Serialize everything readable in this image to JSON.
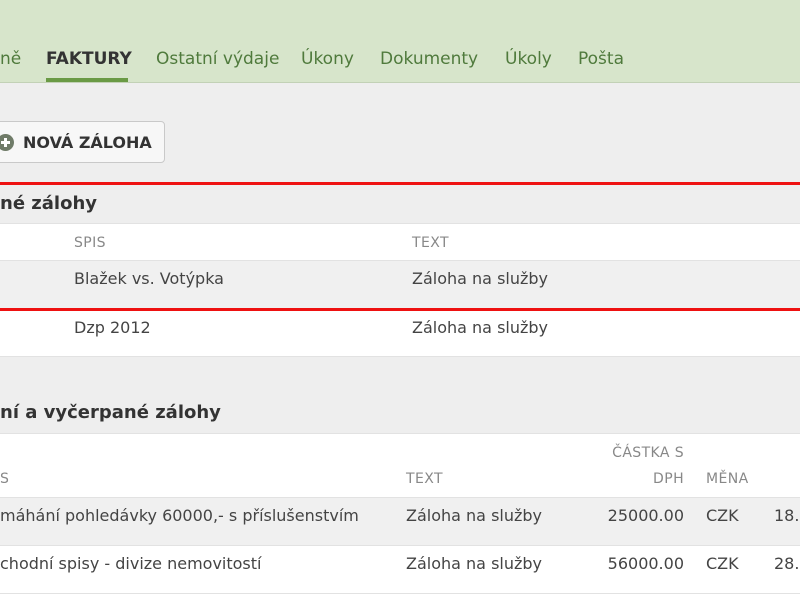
{
  "nav": {
    "tabs": [
      {
        "label": "ně",
        "active": false
      },
      {
        "label": "FAKTURY",
        "active": true
      },
      {
        "label": "Ostatní výdaje",
        "active": false
      },
      {
        "label": "Úkony",
        "active": false
      },
      {
        "label": "Dokumenty",
        "active": false
      },
      {
        "label": "Úkoly",
        "active": false
      },
      {
        "label": "Pošta",
        "active": false
      }
    ]
  },
  "actions": {
    "new_advance_label": "NOVÁ ZÁLOHA"
  },
  "open_advances": {
    "title": "né zálohy",
    "headers": {
      "spis": "SPIS",
      "text": "TEXT"
    },
    "rows": [
      {
        "spis": "Blažek vs. Votýpka",
        "text": "Záloha na služby"
      },
      {
        "spis": "Dzp 2012",
        "text": "Záloha na služby"
      }
    ]
  },
  "closed_advances": {
    "title": "ní a vyčerpané zálohy",
    "headers": {
      "spis": "S",
      "text": "TEXT",
      "amount_line1": "ČÁSTKA S",
      "amount_line2": "DPH",
      "currency": "MĚNA"
    },
    "rows": [
      {
        "spis": "máhání pohledávky 60000,- s příslušenstvím",
        "text": "Záloha na služby",
        "amount": "25000.00",
        "currency": "CZK",
        "date": "18."
      },
      {
        "spis": "chodní spisy - divize nemovitostí",
        "text": "Záloha na služby",
        "amount": "56000.00",
        "currency": "CZK",
        "date": "28."
      }
    ]
  },
  "colors": {
    "topbar": "#d7e5cb",
    "tab_link": "#4f7a3c",
    "tab_underline": "#6a9a45",
    "highlight_line": "#ee1111"
  }
}
